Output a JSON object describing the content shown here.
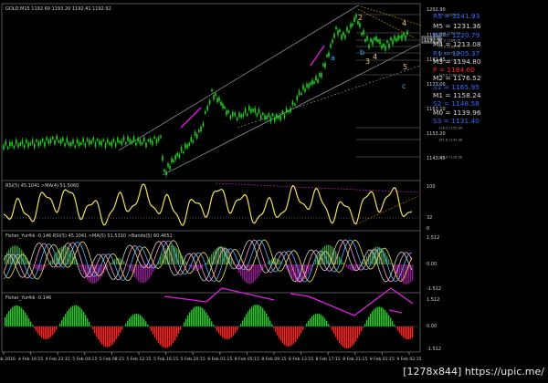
{
  "panels": {
    "main": {
      "info": "GOLD,M15  1192.69 1193.20 1192.41 1192.92",
      "prices": [
        "1202.90",
        "1193.00",
        "1182.85",
        "1173.00",
        "1163.10",
        "1153.20",
        "1143.45"
      ],
      "current_price": "1192.92"
    },
    "rsi": {
      "info": "RSI(5) 45.1041   >MA(4) 51.5060",
      "levels": [
        "100",
        "32",
        "0"
      ]
    },
    "fisher_a": {
      "info": "Fisher_Yur4ik -0.146  RSI(5) 45.1041  >MA(5) 51.5310  >Bands(5) 60.4651",
      "levels": [
        "1.512",
        "0.00",
        "-1.512"
      ]
    },
    "fisher_b": {
      "info": "Fisher_Yur4ik -0.146",
      "levels": [
        "1.512",
        "0.00",
        "-1.512"
      ]
    }
  },
  "fib_labels": [
    "0.0  1202.50",
    "23.6  1193.54",
    "38.2  1188.00",
    "50.0  1183.52",
    "61.8  1179.04",
    "76.4  1173.50",
    "100.0  1164.54",
    "138.2  1150.04",
    "161.8  1141.08",
    "200.0  1126.58"
  ],
  "pivot_levels": [
    {
      "label": "R5 = 1241.93",
      "color": "#2f6bff"
    },
    {
      "label": "M5 = 1231.36",
      "color": "#d9d9d9"
    },
    {
      "label": "R4 = 1220.79",
      "color": "#2f6bff"
    },
    {
      "label": "M4 = 1213.08",
      "color": "#d9d9d9"
    },
    {
      "label": "R1 = 1205.37",
      "color": "#2f6bff"
    },
    {
      "label": "M3 = 1194.80",
      "color": "#d9d9d9"
    },
    {
      "label": "P  = 1184.60",
      "color": "#ff2020"
    },
    {
      "label": "M2 = 1176.52",
      "color": "#d9d9d9"
    },
    {
      "label": "S1 = 1165.95",
      "color": "#2f6bff"
    },
    {
      "label": "M1 = 1158.24",
      "color": "#d9d9d9"
    },
    {
      "label": "S2 = 1148.58",
      "color": "#2f6bff"
    },
    {
      "label": "M0 = 1139.96",
      "color": "#d9d9d9"
    },
    {
      "label": "S3 = 1131.40",
      "color": "#2f6bff"
    }
  ],
  "wave_labels": {
    "main": [
      "2",
      "3",
      "4",
      "a",
      "b",
      "c",
      "5",
      "4"
    ],
    "colors": {
      "2": "#e8c17a",
      "3": "#e8c17a",
      "4": "#e8c17a",
      "5": "#e8c17a",
      "a": "#3fa9ff",
      "b": "#3fa9ff",
      "c": "#3fa9ff"
    }
  },
  "time_axis": [
    "4 Feb 2016",
    "4 Feb 19:15",
    "4 Feb 23:15",
    "5 Feb 04:15",
    "5 Feb 08:15",
    "5 Feb 12:15",
    "5 Feb 16:15",
    "5 Feb 20:15",
    "8 Feb 01:15",
    "8 Feb 05:15",
    "8 Feb 09:15",
    "8 Feb 13:15",
    "8 Feb 17:15",
    "8 Feb 21:15",
    "9 Feb 01:15",
    "9 Feb 02:15"
  ],
  "colors": {
    "bg": "#000000",
    "grid": "#3a3a3a",
    "candle": "#22cc22",
    "rsi": "#f2e15a",
    "magenta": "#e61ce6",
    "channel": "#9aa4b0",
    "fib": "#7a7a7a",
    "hist_pos": "#22cc22",
    "hist_neg": "#ff2020"
  },
  "watermark": "[1278x844] https://upic.me/"
}
